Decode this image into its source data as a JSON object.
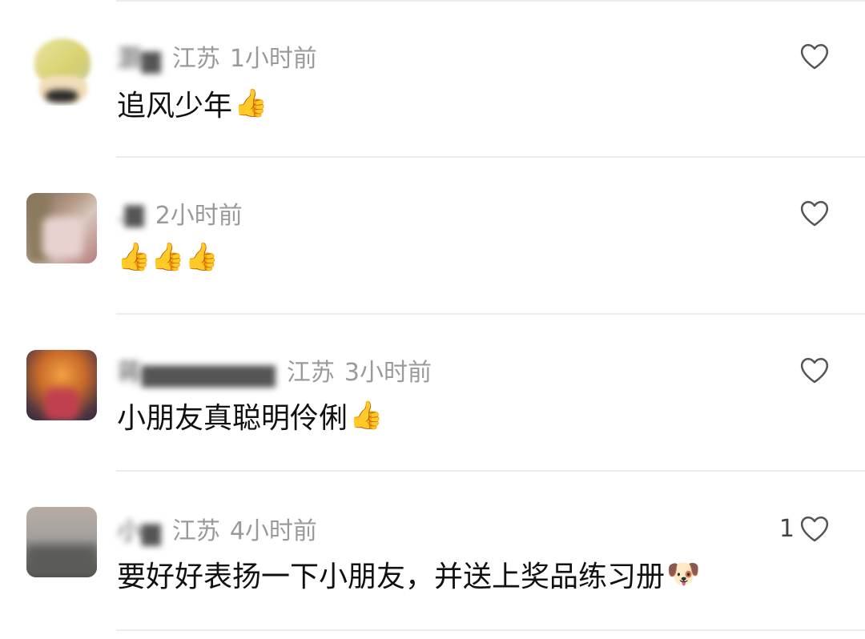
{
  "comments": [
    {
      "name": "灏▆",
      "region": "江苏",
      "time": "1小时前",
      "text": "追风少年",
      "emoji": "👍",
      "likes": "",
      "avatar_icon": "user-avatar-blurred"
    },
    {
      "name": ".▆",
      "region": "",
      "time": "2小时前",
      "text": "",
      "emoji": "👍👍👍",
      "likes": "",
      "avatar_icon": "user-avatar-blurred"
    },
    {
      "name": "蒋▆▆▆▆▆▆▆",
      "region": "江苏",
      "time": "3小时前",
      "text": "小朋友真聪明伶俐",
      "emoji": "👍",
      "likes": "",
      "avatar_icon": "user-avatar-blurred"
    },
    {
      "name": "小▆",
      "region": "江苏",
      "time": "4小时前",
      "text": "要好好表扬一下小朋友，并送上奖品练习册",
      "emoji": "🐶",
      "likes": "1",
      "avatar_icon": "user-avatar-blurred"
    }
  ],
  "icons": {
    "like": "heart-outline-icon"
  },
  "colors": {
    "meta_text": "#9a9a9a",
    "divider": "#ececec",
    "heart": "#555555"
  }
}
